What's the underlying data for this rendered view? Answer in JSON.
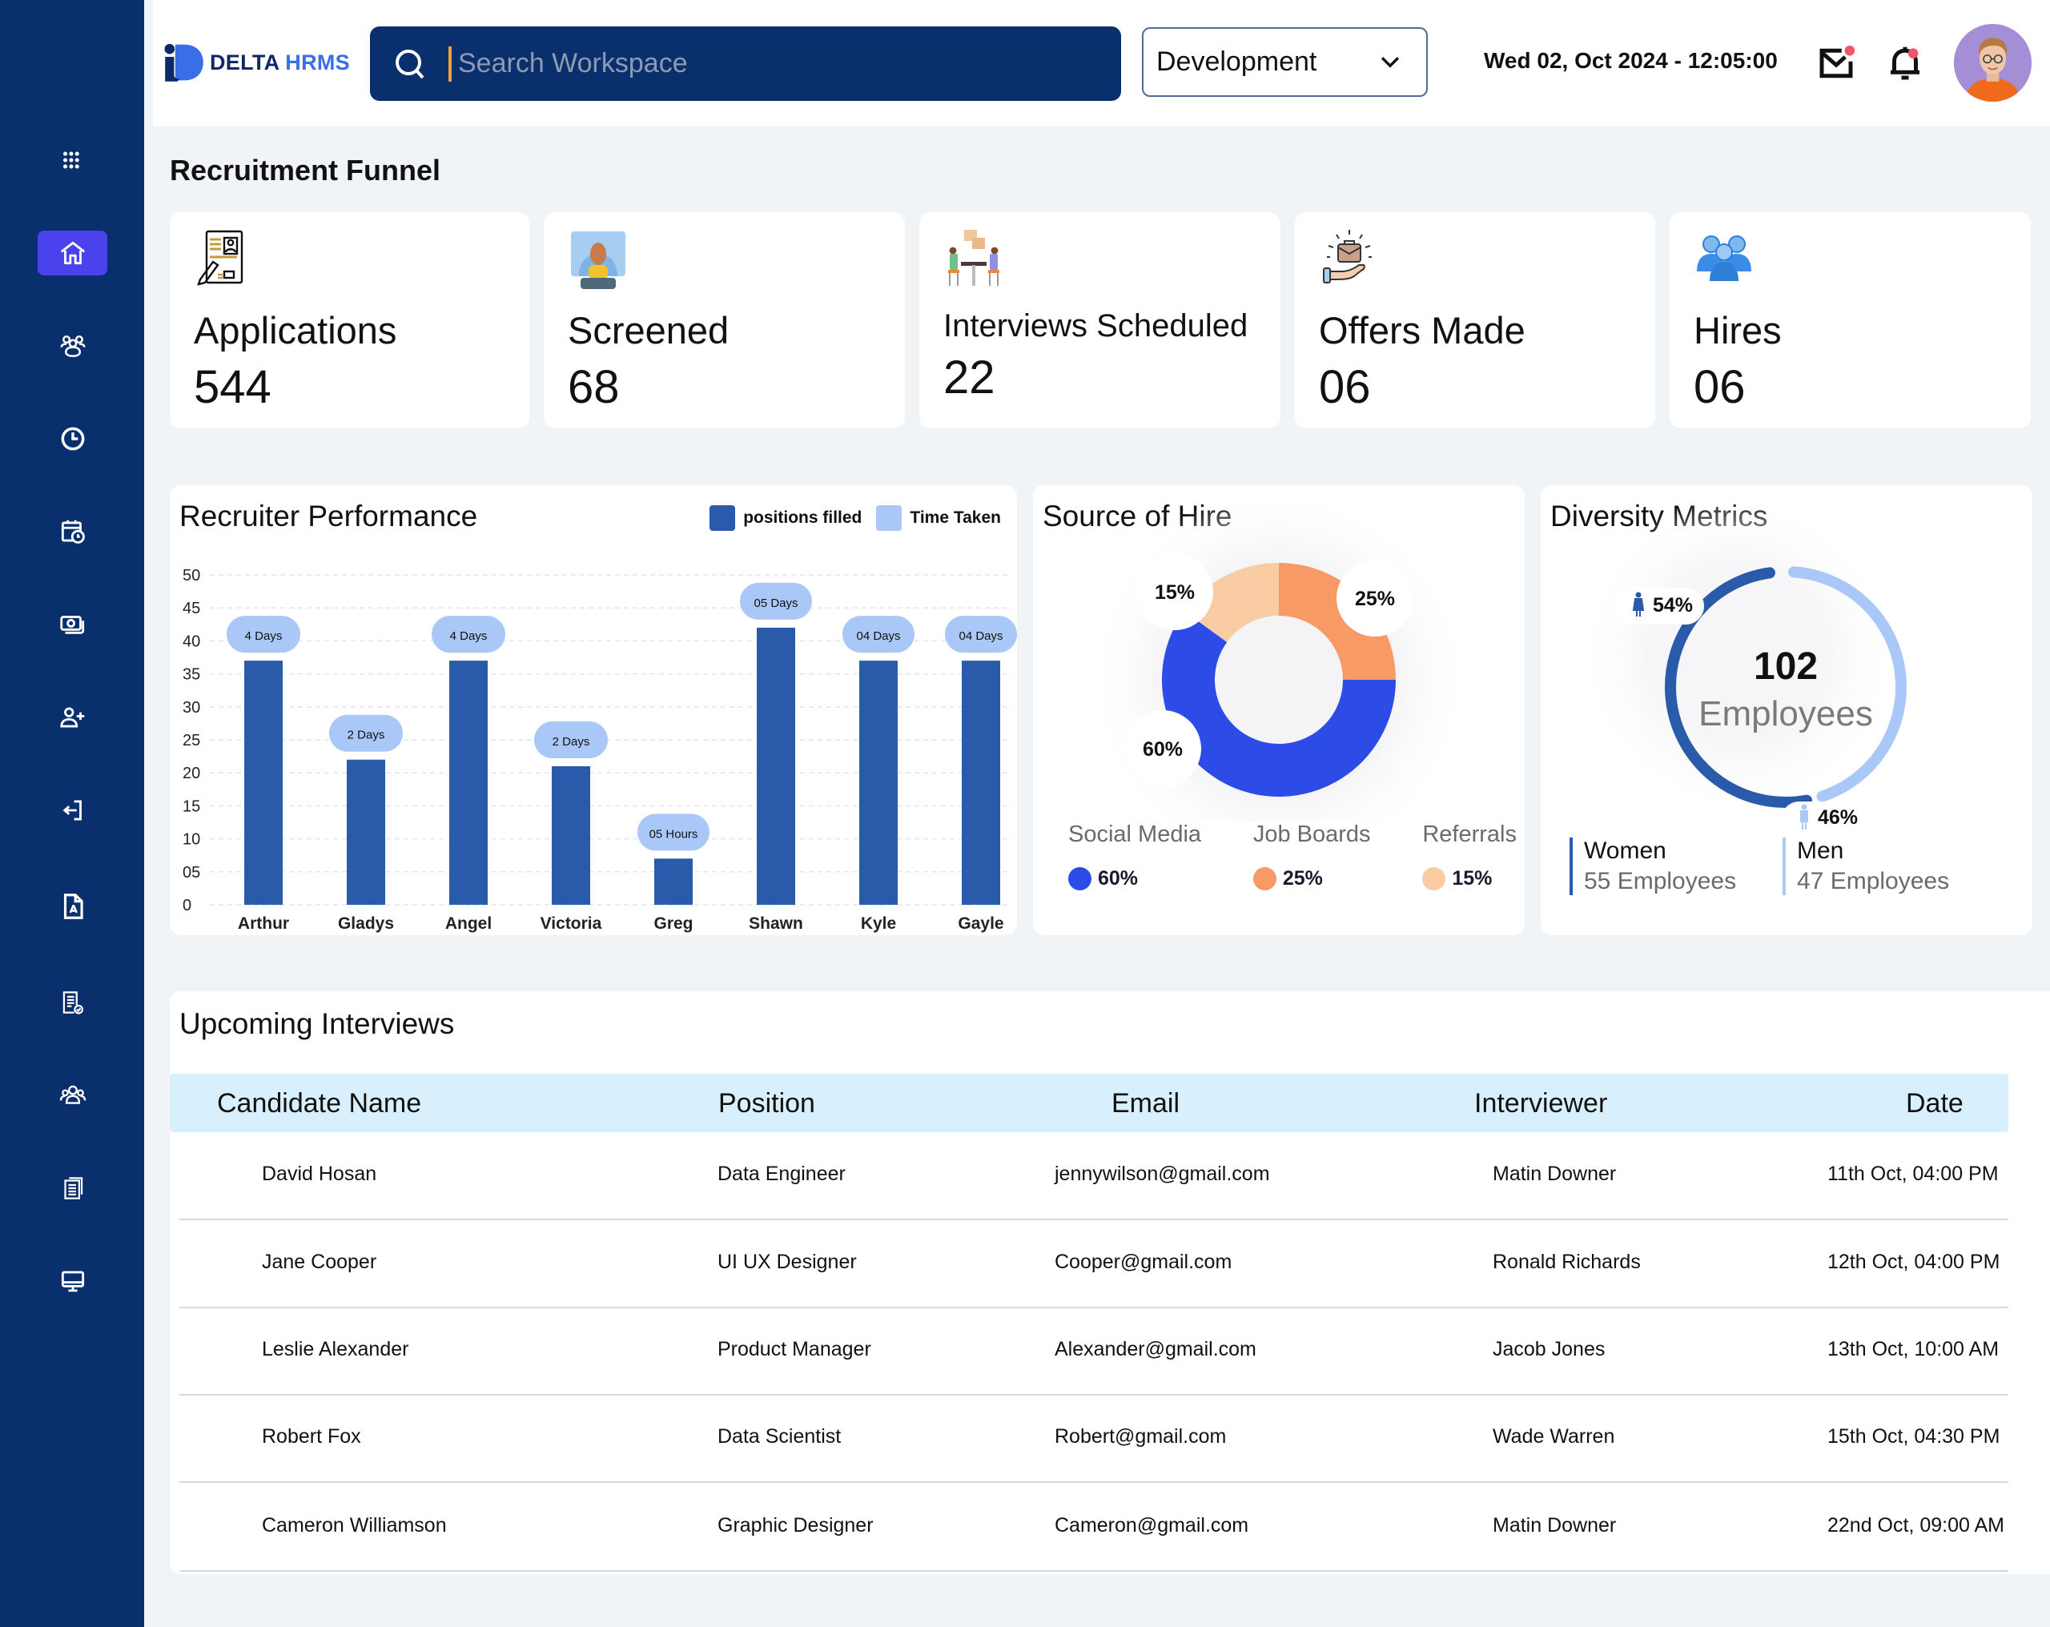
{
  "app": {
    "brand_primary": "DELTA",
    "brand_secondary": "HRMS"
  },
  "colors": {
    "sidebar_bg": "#09306c",
    "sidebar_active": "#4a42ec",
    "bar_primary": "#2a5bab",
    "bar_label_bg": "#a9c8f7",
    "social_media": "#2d4be6",
    "job_boards": "#f79a66",
    "referrals": "#f9cca3",
    "women": "#2a5bab",
    "men": "#a9c8f7"
  },
  "sidebar": {
    "items": [
      {
        "icon": "apps-grid-icon",
        "active": false
      },
      {
        "icon": "home-icon",
        "active": true
      },
      {
        "icon": "team-icon",
        "active": false
      },
      {
        "icon": "clock-icon",
        "active": false
      },
      {
        "icon": "calendar-clock-icon",
        "active": false
      },
      {
        "icon": "payroll-money-icon",
        "active": false
      },
      {
        "icon": "add-user-icon",
        "active": false
      },
      {
        "icon": "logout-icon",
        "active": false
      },
      {
        "icon": "pdf-document-icon",
        "active": false
      },
      {
        "icon": "checklist-icon",
        "active": false
      },
      {
        "icon": "group-icon",
        "active": false
      },
      {
        "icon": "documents-icon",
        "active": false
      },
      {
        "icon": "monitor-icon",
        "active": false
      }
    ]
  },
  "header": {
    "search_placeholder": "Search Workspace",
    "search_value": "",
    "department_selected": "Development",
    "datetime": "Wed 02, Oct 2024 - 12:05:00",
    "mail_has_notification": true,
    "bell_has_notification": true
  },
  "funnel": {
    "title": "Recruitment Funnel",
    "cards": [
      {
        "label": "Applications",
        "value": "544",
        "icon": "application-form-icon"
      },
      {
        "label": "Screened",
        "value": "68",
        "icon": "screened-candidate-icon"
      },
      {
        "label": "Interviews Scheduled",
        "value": "22",
        "icon": "interview-meeting-icon"
      },
      {
        "label": "Offers Made",
        "value": "06",
        "icon": "offer-briefcase-icon"
      },
      {
        "label": "Hires",
        "value": "06",
        "icon": "hires-group-icon"
      }
    ]
  },
  "recruiter_performance": {
    "title": "Recruiter Performance",
    "legend": [
      "positions filled",
      "Time Taken"
    ]
  },
  "source_of_hire": {
    "title": "Source of Hire",
    "items": [
      {
        "name": "Social Media",
        "percent_label": "60%"
      },
      {
        "name": "Job Boards",
        "percent_label": "25%"
      },
      {
        "name": "Referrals",
        "percent_label": "15%"
      }
    ]
  },
  "diversity": {
    "title": "Diversity Metrics",
    "total": "102",
    "total_label": "Employees",
    "women_percent_label": "54%",
    "men_percent_label": "46%",
    "women": {
      "label": "Women",
      "count": "55 Employees"
    },
    "men": {
      "label": "Men",
      "count": "47 Employees"
    }
  },
  "chart_data": [
    {
      "type": "bar",
      "title": "Recruiter Performance",
      "categories": [
        "Arthur",
        "Gladys",
        "Angel",
        "Victoria",
        "Greg",
        "Shawn",
        "Kyle",
        "Gayle"
      ],
      "series": [
        {
          "name": "positions filled",
          "values": [
            37,
            22,
            37,
            21,
            7,
            42,
            37,
            37
          ]
        }
      ],
      "time_taken_labels": [
        "4 Days",
        "2 Days",
        "4 Days",
        "2 Days",
        "05 Hours",
        "05 Days",
        "04 Days",
        "04 Days"
      ],
      "legend": [
        "positions filled",
        "Time Taken"
      ],
      "legend_position": "top-right",
      "yticks": [
        "0",
        "05",
        "10",
        "15",
        "20",
        "25",
        "30",
        "35",
        "40",
        "45",
        "50"
      ],
      "ylim": [
        0,
        50
      ],
      "grid": true,
      "xlabel": "",
      "ylabel": ""
    },
    {
      "type": "pie",
      "title": "Source of Hire",
      "categories": [
        "Social Media",
        "Job Boards",
        "Referrals"
      ],
      "values": [
        60,
        25,
        15
      ],
      "labels": [
        "60%",
        "25%",
        "15%"
      ],
      "donut": true,
      "legend_position": "bottom"
    },
    {
      "type": "pie",
      "title": "Diversity Metrics",
      "categories": [
        "Women",
        "Men"
      ],
      "values": [
        54,
        46
      ],
      "labels": [
        "54%",
        "46%"
      ],
      "counts": [
        55,
        47
      ],
      "center_text": "102 Employees",
      "donut": true,
      "legend_position": "bottom"
    }
  ],
  "interviews": {
    "title": "Upcoming Interviews",
    "columns": [
      "Candidate Name",
      "Position",
      "Email",
      "Interviewer",
      "Date"
    ],
    "rows": [
      [
        "David Hosan",
        "Data Engineer",
        "jennywilson@gmail.com",
        "Matin Downer",
        "11th Oct, 04:00 PM"
      ],
      [
        "Jane Cooper",
        "UI UX Designer",
        "Cooper@gmail.com",
        "Ronald Richards",
        "12th Oct, 04:00 PM"
      ],
      [
        "Leslie Alexander",
        "Product Manager",
        "Alexander@gmail.com",
        "Jacob Jones",
        "13th Oct, 10:00 AM"
      ],
      [
        "Robert Fox",
        "Data Scientist",
        "Robert@gmail.com",
        "Wade Warren",
        "15th Oct, 04:30 PM"
      ],
      [
        "Cameron Williamson",
        "Graphic Designer",
        "Cameron@gmail.com",
        "Matin Downer",
        "22nd Oct, 09:00 AM"
      ]
    ]
  }
}
